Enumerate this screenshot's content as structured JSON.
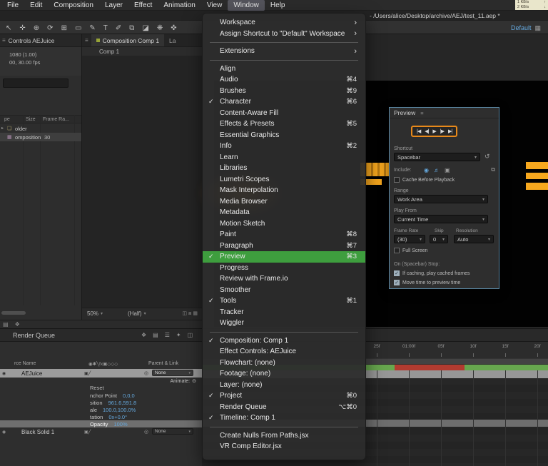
{
  "colors": {
    "menu_highlight": "#3e9e3e",
    "transport_highlight": "#e8891a",
    "cache_green": "#67a74e",
    "cache_red": "#b23b30",
    "accent_blue": "#64a7dc",
    "selected_row": "#9c9c9c",
    "tab_dot": "#97a437"
  },
  "icons": {
    "panel_menu": "≡",
    "dropdown_arrow": "▾",
    "submenu_arrow": "›",
    "check": "✓",
    "reset": "↺",
    "stopwatch": "⊙",
    "pickwhip": "◎",
    "eye": "◉",
    "collapse": "▸",
    "folder": "❏",
    "composition": "▦",
    "grid": "▦",
    "net_up": "↑",
    "net_down": "↓"
  },
  "menubar": {
    "items": [
      {
        "label": "File"
      },
      {
        "label": "Edit"
      },
      {
        "label": "Composition"
      },
      {
        "label": "Layer"
      },
      {
        "label": "Effect"
      },
      {
        "label": "Animation"
      },
      {
        "label": "View"
      },
      {
        "label": "Window",
        "active": true
      },
      {
        "label": "Help"
      }
    ]
  },
  "titlebar": {
    "path": "- /Users/alice/Desktop/archive/AEJ/test_11.aep *"
  },
  "network_badge": {
    "up": "1 KB/s",
    "down": "2 KB/s"
  },
  "toolbar": {
    "workspace_label": "Default",
    "tools": [
      {
        "name": "selection-tool-icon",
        "glyph": "↖"
      },
      {
        "name": "hand-tool-icon",
        "glyph": "✛"
      },
      {
        "name": "zoom-tool-icon",
        "glyph": "⊕"
      },
      {
        "name": "orbit-camera-tool-icon",
        "glyph": "⟳"
      },
      {
        "name": "pan-behind-tool-icon",
        "glyph": "⊞"
      },
      {
        "name": "shape-tool-icon",
        "glyph": "▭"
      },
      {
        "name": "pen-tool-icon",
        "glyph": "✎"
      },
      {
        "name": "type-tool-icon",
        "glyph": "T"
      },
      {
        "name": "brush-tool-icon",
        "glyph": "✐"
      },
      {
        "name": "clone-stamp-tool-icon",
        "glyph": "⧉"
      },
      {
        "name": "eraser-tool-icon",
        "glyph": "◪"
      },
      {
        "name": "roto-brush-tool-icon",
        "glyph": "❋"
      },
      {
        "name": "puppet-pin-tool-icon",
        "glyph": "✜"
      }
    ]
  },
  "project_panel": {
    "tab_label": "Controls AEJuice",
    "info_line1": "1080 (1.00)",
    "info_line2": "00, 30.00 fps",
    "columns": [
      "pe",
      "Size",
      "Frame Ra..."
    ],
    "rows": [
      {
        "label": "older",
        "frame_rate": ""
      },
      {
        "label": "omposition",
        "frame_rate": "30"
      }
    ],
    "bottom_icons": [
      {
        "name": "project-flowchart-icon",
        "glyph": "▤"
      },
      {
        "name": "new-folder-icon",
        "glyph": "❖"
      }
    ]
  },
  "comp_panel": {
    "tab_label": "Composition Comp 1",
    "tab2_label": "La",
    "breadcrumb": "Comp 1",
    "zoom_value": "50%",
    "resolution_value": "(Half)",
    "bottom_icons": "◫ ⧈ ▦"
  },
  "preview_panel": {
    "title": "Preview",
    "transport": [
      {
        "name": "go-to-start-button",
        "glyph": "|◀"
      },
      {
        "name": "previous-frame-button",
        "glyph": "◀|"
      },
      {
        "name": "play-button",
        "glyph": "▶"
      },
      {
        "name": "next-frame-button",
        "glyph": "|▶"
      },
      {
        "name": "go-to-end-button",
        "glyph": "▶|"
      }
    ],
    "shortcut_label": "Shortcut",
    "shortcut_value": "Spacebar",
    "include_label": "Include:",
    "include_icons": [
      {
        "name": "video-preview-icon",
        "glyph": "◉",
        "accent": true
      },
      {
        "name": "audio-preview-icon",
        "glyph": "♬",
        "accent": true
      },
      {
        "name": "overlays-icon",
        "glyph": "▣",
        "accent": false
      },
      {
        "name": "frame-render-icon",
        "glyph": "⧉",
        "accent": false
      }
    ],
    "cache_checkbox": "Cache Before Playback",
    "range_label": "Range",
    "range_value": "Work Area",
    "play_from_label": "Play From",
    "play_from_value": "Current Time",
    "frame_rate_label": "Frame Rate",
    "skip_label": "Skip",
    "resolution_label": "Resolution",
    "frame_rate_value": "(30)",
    "skip_value": "0",
    "resolution_value": "Auto",
    "full_screen_checkbox": "Full Screen",
    "stop_label": "On (Spacebar) Stop:",
    "option1": "If caching, play cached frames",
    "option2": "Move time to preview time"
  },
  "timeline": {
    "render_queue_label": "Render Queue",
    "option_icons": [
      {
        "name": "live-update-icon",
        "glyph": "❖"
      },
      {
        "name": "draft-3d-icon",
        "glyph": "▤"
      },
      {
        "name": "graph-editor-icon",
        "glyph": "☰"
      },
      {
        "name": "motion-blur-icon",
        "glyph": "✦"
      },
      {
        "name": "frame-blend-icon",
        "glyph": "◫"
      }
    ],
    "columns_header": "rce Name",
    "switch_icons": "◉✱╲fx▣◇◇◇",
    "parent_link_header": "Parent & Link",
    "ruler_ticks": [
      "25f",
      "01:00f",
      "05f",
      "10f",
      "15f",
      "20f"
    ],
    "layer1": {
      "name": "AEJuice",
      "switches": "▣╱",
      "parent": "None"
    },
    "layer2": {
      "name": "Black Solid 1",
      "switches": "▣╱",
      "parent": "None"
    },
    "animate_label": "Animate:",
    "reset_label": "Reset",
    "properties": [
      {
        "name": "nchor Point",
        "value": "0,0,0"
      },
      {
        "name": "sition",
        "value": "961.6,591.8"
      },
      {
        "name": "ale",
        "value": "100.0,100.0%"
      },
      {
        "name": "tation",
        "value": "0x+0.0°"
      },
      {
        "name": "Opacity",
        "value": "100%",
        "selected": true
      }
    ]
  },
  "window_menu": {
    "items": [
      {
        "label": "Workspace",
        "submenu": true
      },
      {
        "label": "Assign Shortcut to \"Default\" Workspace",
        "submenu": true
      },
      {
        "separator": true
      },
      {
        "label": "Extensions",
        "submenu": true
      },
      {
        "separator": true
      },
      {
        "label": "Align"
      },
      {
        "label": "Audio",
        "shortcut": "⌘4"
      },
      {
        "label": "Brushes",
        "shortcut": "⌘9"
      },
      {
        "label": "Character",
        "shortcut": "⌘6",
        "checked": true
      },
      {
        "label": "Content-Aware Fill"
      },
      {
        "label": "Effects & Presets",
        "shortcut": "⌘5"
      },
      {
        "label": "Essential Graphics"
      },
      {
        "label": "Info",
        "shortcut": "⌘2"
      },
      {
        "label": "Learn"
      },
      {
        "label": "Libraries"
      },
      {
        "label": "Lumetri Scopes"
      },
      {
        "label": "Mask Interpolation"
      },
      {
        "label": "Media Browser"
      },
      {
        "label": "Metadata"
      },
      {
        "label": "Motion Sketch"
      },
      {
        "label": "Paint",
        "shortcut": "⌘8"
      },
      {
        "label": "Paragraph",
        "shortcut": "⌘7"
      },
      {
        "label": "Preview",
        "shortcut": "⌘3",
        "checked": true,
        "highlighted": true
      },
      {
        "label": "Progress"
      },
      {
        "label": "Review with Frame.io"
      },
      {
        "label": "Smoother"
      },
      {
        "label": "Tools",
        "shortcut": "⌘1",
        "checked": true
      },
      {
        "label": "Tracker"
      },
      {
        "label": "Wiggler"
      },
      {
        "separator": true
      },
      {
        "label": "Composition: Comp 1",
        "checked": true
      },
      {
        "label": "Effect Controls: AEJuice"
      },
      {
        "label": "Flowchart: (none)"
      },
      {
        "label": "Footage: (none)"
      },
      {
        "label": "Layer: (none)"
      },
      {
        "label": "Project",
        "shortcut": "⌘0",
        "checked": true
      },
      {
        "label": "Render Queue",
        "shortcut": "⌥⌘0"
      },
      {
        "label": "Timeline: Comp 1",
        "checked": true
      },
      {
        "separator": true
      },
      {
        "label": "Create Nulls From Paths.jsx"
      },
      {
        "label": "VR Comp Editor.jsx"
      }
    ]
  }
}
